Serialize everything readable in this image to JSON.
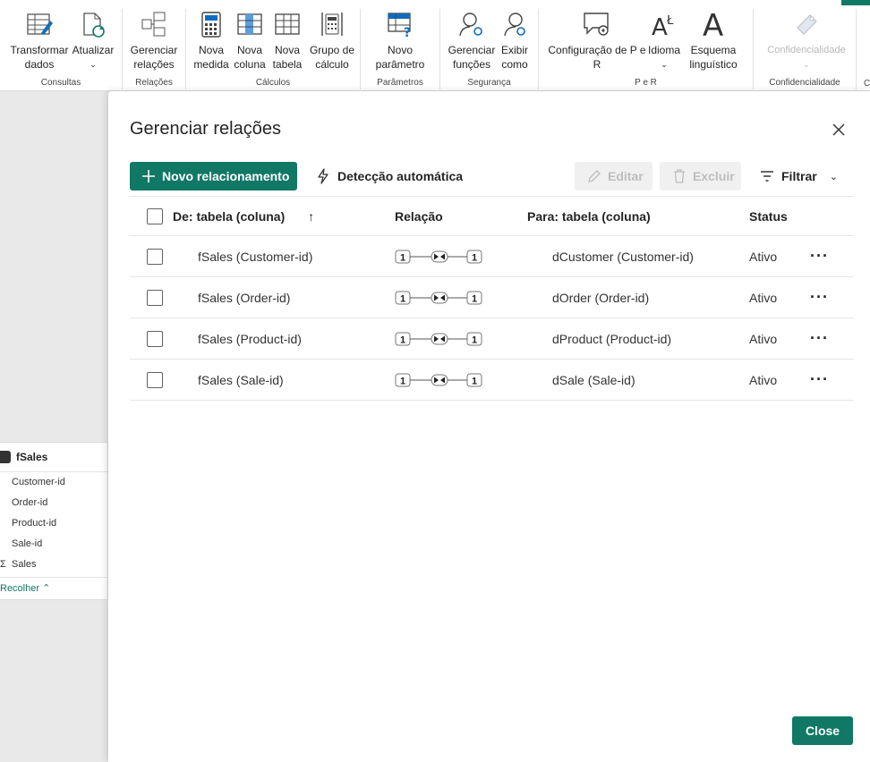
{
  "ribbon": {
    "groups": [
      {
        "label": "Consultas",
        "buttons": [
          {
            "label": "Transformar dados",
            "icon": "transform-icon",
            "dropdown": true
          },
          {
            "label": "Atualizar",
            "icon": "refresh-icon",
            "dropdown": true
          }
        ]
      },
      {
        "label": "Relações",
        "buttons": [
          {
            "label": "Gerenciar relações",
            "icon": "relations-icon"
          }
        ]
      },
      {
        "label": "Cálculos",
        "buttons": [
          {
            "label": "Nova medida",
            "icon": "calculator-icon"
          },
          {
            "label": "Nova coluna",
            "icon": "column-icon"
          },
          {
            "label": "Nova tabela",
            "icon": "table-icon"
          },
          {
            "label": "Grupo de cálculo",
            "icon": "calc-group-icon"
          }
        ]
      },
      {
        "label": "Parâmetros",
        "buttons": [
          {
            "label": "Novo parâmetro",
            "icon": "parameter-icon",
            "dropdown": true
          }
        ]
      },
      {
        "label": "Segurança",
        "buttons": [
          {
            "label": "Gerenciar funções",
            "icon": "roles-icon"
          },
          {
            "label": "Exibir como",
            "icon": "view-as-icon"
          }
        ]
      },
      {
        "label": "P e R",
        "buttons": [
          {
            "label": "Configuração de P e R",
            "icon": "qa-setup-icon"
          },
          {
            "label": "Idioma",
            "icon": "language-icon",
            "dropdown": true
          },
          {
            "label": "Esquema linguístico",
            "icon": "linguistic-icon",
            "dropdown": true
          }
        ]
      },
      {
        "label": "Confidencialidade",
        "buttons": [
          {
            "label": "Confidencialidade",
            "icon": "sensitivity-icon",
            "dropdown": true,
            "disabled": true
          }
        ]
      }
    ],
    "trailing_label": "C"
  },
  "canvas": {
    "table_card": {
      "name": "fSales",
      "fields": [
        "Customer-id",
        "Order-id",
        "Product-id",
        "Sale-id",
        "Sales"
      ],
      "collapse_label": "Recolher"
    }
  },
  "dialog": {
    "title": "Gerenciar relações",
    "toolbar": {
      "new_label": "Novo relacionamento",
      "auto_label": "Detecção automática",
      "edit_label": "Editar",
      "delete_label": "Excluir",
      "filter_label": "Filtrar"
    },
    "columns": {
      "from": "De: tabela (coluna)",
      "relation": "Relação",
      "to": "Para: tabela (coluna)",
      "status": "Status"
    },
    "rows": [
      {
        "from": "fSales (Customer-id)",
        "left_card": "1",
        "right_card": "1",
        "to": "dCustomer (Customer-id)",
        "status": "Ativo"
      },
      {
        "from": "fSales (Order-id)",
        "left_card": "1",
        "right_card": "1",
        "to": "dOrder (Order-id)",
        "status": "Ativo"
      },
      {
        "from": "fSales (Product-id)",
        "left_card": "1",
        "right_card": "1",
        "to": "dProduct (Product-id)",
        "status": "Ativo"
      },
      {
        "from": "fSales (Sale-id)",
        "left_card": "1",
        "right_card": "1",
        "to": "dSale (Sale-id)",
        "status": "Ativo"
      }
    ],
    "close_label": "Close"
  },
  "colors": {
    "accent": "#117865",
    "ribbon_icon_blue": "#0f6cbd"
  }
}
